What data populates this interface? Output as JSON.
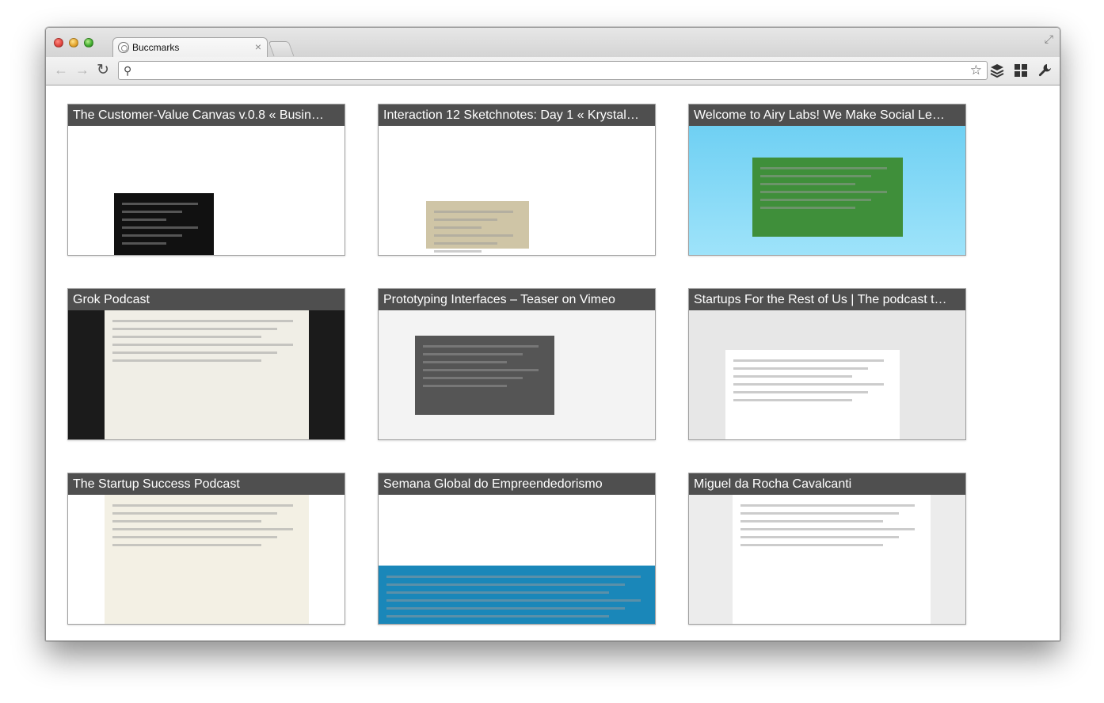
{
  "window": {
    "tab_title": "Buccmarks",
    "tab_close": "×"
  },
  "toolbar": {
    "back_icon": "←",
    "forward_icon": "→",
    "reload_icon": "↻",
    "omnibox_value": "",
    "search_icon": "⚲",
    "star_icon": "☆"
  },
  "thumbnails": [
    {
      "title": "The Customer-Value Canvas v.0.8 « Busin…",
      "accent": "#1a1a1a"
    },
    {
      "title": "Interaction 12 Sketchnotes: Day 1 « Krystal…",
      "accent": "#cc2222"
    },
    {
      "title": "Welcome to Airy Labs! We Make Social Le…",
      "accent": "#55bfe8"
    },
    {
      "title": "Grok Podcast",
      "accent": "#111111"
    },
    {
      "title": "Prototyping Interfaces – Teaser on Vimeo",
      "accent": "#3b6e9a"
    },
    {
      "title": "Startups For the Rest of Us | The podcast t…",
      "accent": "#3a6f8f"
    },
    {
      "title": "The Startup Success Podcast",
      "accent": "#ffffff"
    },
    {
      "title": "Semana Global do Empreendedorismo",
      "accent": "#1a87b9"
    },
    {
      "title": "Miguel da Rocha Cavalcanti",
      "accent": "#dcdcdc"
    }
  ]
}
